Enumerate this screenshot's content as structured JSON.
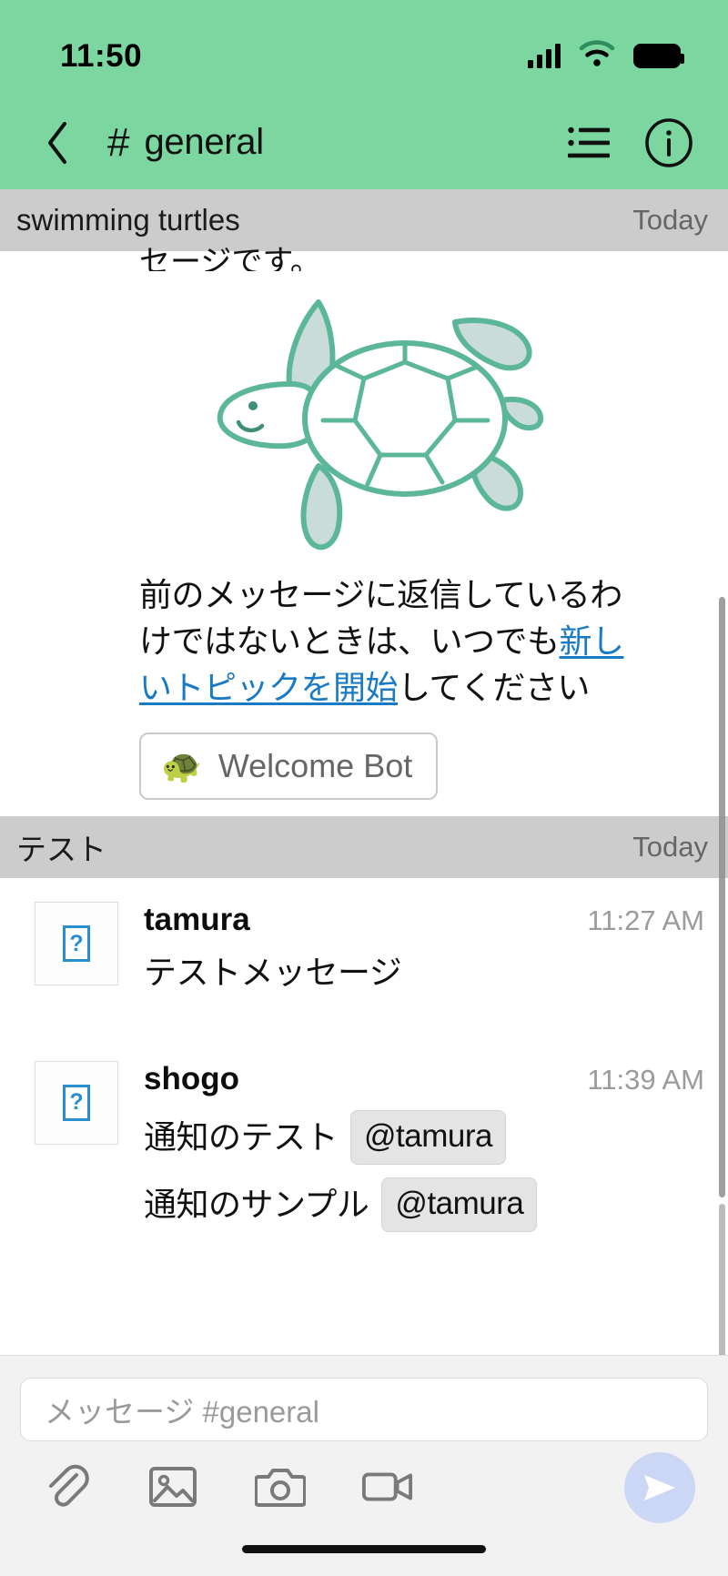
{
  "status_bar": {
    "time": "11:50",
    "signal_icon": "cellular-signal-icon",
    "wifi_icon": "wifi-icon",
    "battery_icon": "battery-full-icon"
  },
  "nav_bar": {
    "back_icon": "chevron-left-icon",
    "hash": "#",
    "channel": "general",
    "list_icon": "topic-list-icon",
    "info_icon": "info-circle-icon"
  },
  "topics": [
    {
      "name": "swimming turtles",
      "date": "Today",
      "clipped_text": "セージです。",
      "illustration": "swimming-turtle-illustration",
      "paragraph_part1": "前のメッセージに返信しているわけではないときは、いつでも",
      "paragraph_link": "新しいトピックを開始",
      "paragraph_part2": "してください",
      "bot_chip": {
        "emoji": "🐢",
        "label": "Welcome Bot"
      }
    },
    {
      "name": "テスト",
      "date": "Today",
      "messages": [
        {
          "author": "tamura",
          "time": "11:27 AM",
          "avatar": "broken-image-placeholder",
          "lines": [
            {
              "text": "テストメッセージ",
              "mention": null
            }
          ]
        },
        {
          "author": "shogo",
          "time": "11:39 AM",
          "avatar": "broken-image-placeholder",
          "lines": [
            {
              "text": "通知のテスト",
              "mention": "@tamura"
            },
            {
              "text": "通知のサンプル",
              "mention": "@tamura"
            }
          ]
        }
      ]
    }
  ],
  "composer": {
    "placeholder": "メッセージ #general",
    "value": "",
    "attach_icon": "paperclip-icon",
    "image_icon": "image-icon",
    "camera_icon": "camera-icon",
    "video_icon": "video-camera-icon",
    "send_icon": "send-plane-icon"
  },
  "colors": {
    "brand_green": "#7BD6A0",
    "topic_header_gray": "#CCCCCC",
    "link_blue": "#1a7bc4",
    "send_button": "#CBD7F5",
    "turtle_outline": "#5cb79a",
    "turtle_fill": "#c9dcd8"
  }
}
